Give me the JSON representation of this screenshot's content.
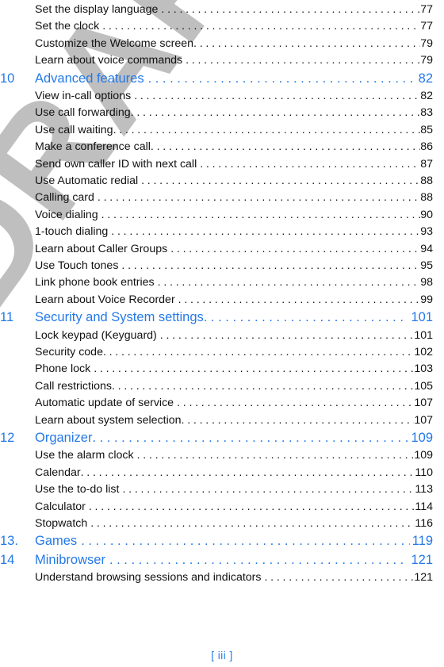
{
  "document": {
    "type": "table-of-contents",
    "accent_color": "#2479e8",
    "text_color": "#111111",
    "watermark_color": "#bfbfbf",
    "background_color": "#ffffff"
  },
  "watermark": {
    "text": "DRAFT"
  },
  "footer": {
    "folio": "[ iii ]"
  },
  "entries": [
    {
      "level": "item",
      "num": "",
      "title": "Set the display language",
      "page": "77",
      "tight": false
    },
    {
      "level": "item",
      "num": "",
      "title": "Set the clock",
      "page": "77",
      "tight": false
    },
    {
      "level": "item",
      "num": "",
      "title": "Customize the Welcome screen",
      "page": "79",
      "tight": true
    },
    {
      "level": "item",
      "num": "",
      "title": "Learn about voice commands",
      "page": "79",
      "tight": false
    },
    {
      "level": "chapter",
      "num": "10",
      "title": "Advanced features",
      "page": "82",
      "tight": false
    },
    {
      "level": "item",
      "num": "",
      "title": "View in-call options",
      "page": "82",
      "tight": false
    },
    {
      "level": "item",
      "num": "",
      "title": "Use call forwarding",
      "page": "83",
      "tight": true
    },
    {
      "level": "item",
      "num": "",
      "title": "Use call waiting",
      "page": "85",
      "tight": true
    },
    {
      "level": "item",
      "num": "",
      "title": "Make a conference call",
      "page": "86",
      "tight": true
    },
    {
      "level": "item",
      "num": "",
      "title": "Send own caller ID with next call",
      "page": "87",
      "tight": false
    },
    {
      "level": "item",
      "num": "",
      "title": "Use Automatic redial",
      "page": "88",
      "tight": false
    },
    {
      "level": "item",
      "num": "",
      "title": "Calling card",
      "page": "88",
      "tight": false
    },
    {
      "level": "item",
      "num": "",
      "title": "Voice dialing",
      "page": "90",
      "tight": false
    },
    {
      "level": "item",
      "num": "",
      "title": "1-touch dialing",
      "page": "93",
      "tight": false
    },
    {
      "level": "item",
      "num": "",
      "title": "Learn about Caller Groups",
      "page": "94",
      "tight": false
    },
    {
      "level": "item",
      "num": "",
      "title": "Use Touch tones",
      "page": "95",
      "tight": false
    },
    {
      "level": "item",
      "num": "",
      "title": "Link phone book entries",
      "page": "98",
      "tight": false
    },
    {
      "level": "item",
      "num": "",
      "title": "Learn about Voice Recorder",
      "page": "99",
      "tight": false
    },
    {
      "level": "chapter",
      "num": "11",
      "title": "Security and System settings",
      "page": "101",
      "tight": true
    },
    {
      "level": "item",
      "num": "",
      "title": "Lock keypad (Keyguard)",
      "page": "101",
      "tight": false
    },
    {
      "level": "item",
      "num": "",
      "title": "Security code",
      "page": "102",
      "tight": true
    },
    {
      "level": "item",
      "num": "",
      "title": "Phone lock",
      "page": "103",
      "tight": false
    },
    {
      "level": "item",
      "num": "",
      "title": "Call restrictions",
      "page": "105",
      "tight": true
    },
    {
      "level": "item",
      "num": "",
      "title": "Automatic update of service",
      "page": "107",
      "tight": false
    },
    {
      "level": "item",
      "num": "",
      "title": "Learn about system selection",
      "page": "107",
      "tight": true
    },
    {
      "level": "chapter",
      "num": "12",
      "title": "Organizer",
      "page": "109",
      "tight": true
    },
    {
      "level": "item",
      "num": "",
      "title": "Use the alarm clock",
      "page": "109",
      "tight": false
    },
    {
      "level": "item",
      "num": "",
      "title": "Calendar",
      "page": "110",
      "tight": true
    },
    {
      "level": "item",
      "num": "",
      "title": "Use the to-do list",
      "page": "113",
      "tight": false
    },
    {
      "level": "item",
      "num": "",
      "title": "Calculator",
      "page": "114",
      "tight": false
    },
    {
      "level": "item",
      "num": "",
      "title": "Stopwatch",
      "page": "116",
      "tight": false
    },
    {
      "level": "chapter",
      "num": "13.",
      "title": "Games",
      "page": "119",
      "tight": false
    },
    {
      "level": "chapter",
      "num": "14",
      "title": "Minibrowser",
      "page": "121",
      "tight": false
    },
    {
      "level": "item",
      "num": "",
      "title": "Understand browsing sessions and indicators",
      "page": "121",
      "tight": false
    }
  ]
}
